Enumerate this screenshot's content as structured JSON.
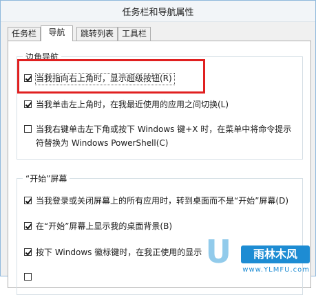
{
  "window": {
    "title": "任务栏和导航属性"
  },
  "tabs": [
    {
      "label": "任务栏",
      "active": false
    },
    {
      "label": "导航",
      "active": true
    },
    {
      "label": "跳转列表",
      "active": false
    },
    {
      "label": "工具栏",
      "active": false
    }
  ],
  "corner_nav": {
    "label": "边角导航",
    "options": [
      {
        "label": "当我指向右上角时，显示超级按钮(R)",
        "checked": true
      },
      {
        "label": "当我单击左上角时，在我最近使用的应用之间切换(L)",
        "checked": true
      },
      {
        "label": "当我右键单击左下角或按下 Windows 键+X 时，在菜单中将命令提示符替换为 Windows PowerShell(C)",
        "checked": false
      }
    ]
  },
  "start_screen": {
    "label": "“开始”屏幕",
    "options": [
      {
        "label": "当我登录或关闭屏幕上的所有应用时，转到桌面而不是“开始”屏幕(D)",
        "checked": true
      },
      {
        "label": "在“开始”屏幕上显示我的桌面背景(B)",
        "checked": true
      },
      {
        "label": "按下 Windows 徽标键时，在我正使用的显示",
        "checked": true
      },
      {
        "label": "",
        "checked": false
      }
    ]
  },
  "watermark": {
    "logo_text": "雨林木风",
    "url": "www.YLMFU.com",
    "big_letter": "U"
  },
  "colors": {
    "highlight": "#e02020",
    "window_border": "#8fb8dc",
    "watermark": "#1d8cd3"
  }
}
